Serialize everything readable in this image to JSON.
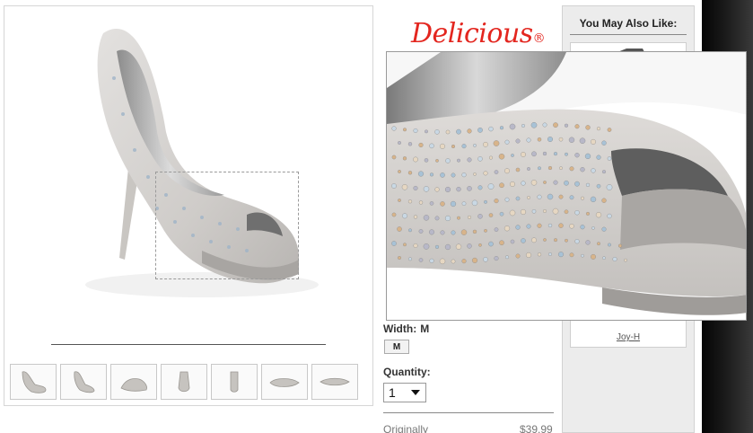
{
  "brand": {
    "logo_text": "Delicious",
    "logo_mark": "®"
  },
  "product": {
    "width_label": "Width:",
    "width_value": "M",
    "width_option": "M",
    "quantity_label": "Quantity:",
    "quantity_value": "1",
    "originally_label": "Originally",
    "original_price": "$39.99"
  },
  "thumbnails": [
    "front-angle",
    "side-angle",
    "profile",
    "front",
    "back",
    "top-view",
    "sole"
  ],
  "sidebar": {
    "title": "You May Also Like:",
    "recommended_item": "Joy-H"
  },
  "colors": {
    "brand_red": "#e3261f",
    "sidebar_bg": "#ececec"
  }
}
